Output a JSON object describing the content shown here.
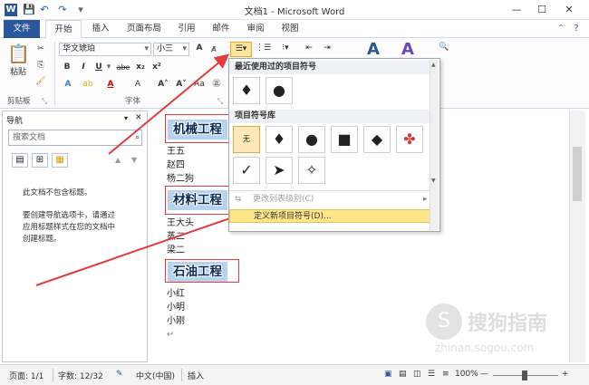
{
  "window": {
    "app_icon": "W",
    "title": "文档1 - Microsoft Word",
    "minimize": "—",
    "maximize": "☐",
    "close": "✕"
  },
  "qat": {
    "save_icon": "floppy-icon",
    "undo_icon": "undo-icon",
    "redo_icon": "redo-icon"
  },
  "tabs": [
    "文件",
    "开始",
    "插入",
    "页面布局",
    "引用",
    "邮件",
    "审阅",
    "视图"
  ],
  "ribbon": {
    "paste_label": "粘贴",
    "clipboard_group": "剪贴板",
    "font_group": "字体",
    "font_name": "华文琥珀",
    "font_size": "小三",
    "bold": "B",
    "italic": "I",
    "underline": "U",
    "strike": "abe",
    "subscript": "x₂",
    "superscript": "x²",
    "grow_font": "A",
    "shrink_font": "A",
    "style_a1": "A",
    "style_a2": "A",
    "find": "A"
  },
  "nav": {
    "title": "导航",
    "search_placeholder": "搜索文档",
    "msg1": "此文档不包含标题。",
    "msg2_lines": [
      "要创建导航选项卡，请通过",
      "应用标题样式在您的文档中",
      "创建标题。"
    ]
  },
  "document": {
    "headings": [
      "机械工程",
      "材料工程",
      "石油工程"
    ],
    "group1": [
      "王五",
      "赵四",
      "杨二狗"
    ],
    "group2": [
      "王大头",
      "蒸二",
      "梁二"
    ],
    "group3": [
      "小红",
      "小明",
      "小刚"
    ],
    "para_mark": "↵"
  },
  "bullet_menu": {
    "recent_header": "最近使用过的项目符号",
    "library_header": "项目符号库",
    "recent": [
      "♦",
      "●"
    ],
    "library_row1": [
      "无",
      "♦",
      "●",
      "■",
      "◆",
      "✤"
    ],
    "library_row2": [
      "✓",
      "➤",
      "✧"
    ],
    "change_level": "更改列表级别(C)",
    "define_new": "定义新项目符号(D)..."
  },
  "status": {
    "page": "页面: 1/1",
    "words": "字数: 12/32",
    "language": "中文(中国)",
    "mode": "插入",
    "zoom": "100%",
    "zoom_out": "—",
    "zoom_in": "+"
  },
  "watermark": {
    "line1": "搜狗指南",
    "line2": "zhinan.sogou.com"
  },
  "colors": {
    "accent": "#2b579a",
    "highlight": "#b5d3f0",
    "annotation_red": "#e23c3c",
    "menu_hover": "#fde68a"
  }
}
